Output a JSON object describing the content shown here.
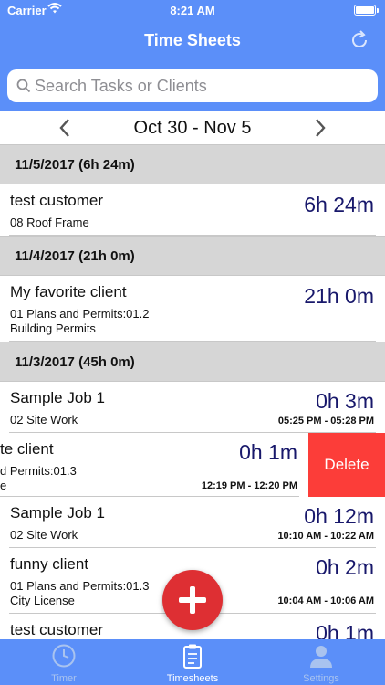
{
  "status": {
    "carrier": "Carrier",
    "time": "8:21 AM"
  },
  "nav": {
    "title": "Time Sheets"
  },
  "search": {
    "placeholder": "Search Tasks or Clients"
  },
  "week": {
    "range": "Oct 30 -  Nov 5"
  },
  "groups": [
    {
      "header": "11/5/2017  (6h 24m)",
      "entries": [
        {
          "client": "test customer",
          "task": "08 Roof Frame",
          "duration": "6h 24m"
        }
      ]
    },
    {
      "header": "11/4/2017  (21h 0m)",
      "entries": [
        {
          "client": "My favorite client",
          "task_line1": "01 Plans and Permits:01.2",
          "task_line2": "Building Permits",
          "duration": "21h 0m"
        }
      ]
    },
    {
      "header": "11/3/2017  (45h 0m)",
      "entries": [
        {
          "client": "Sample Job 1",
          "task": "02 Site Work",
          "duration": "0h 3m",
          "times": "05:25 PM  -  05:28 PM"
        },
        {
          "client": "te client",
          "task_line1": "d Permits:01.3",
          "task_line2": "e",
          "duration": "0h 1m",
          "times": "12:19 PM  -  12:20 PM",
          "action": "Delete"
        },
        {
          "client": "Sample Job 1",
          "task": "02 Site Work",
          "duration": "0h 12m",
          "times": "10:10 AM  -  10:22 AM"
        },
        {
          "client": "funny client",
          "task_line1": "01 Plans and Permits:01.3",
          "task_line2": "City License",
          "duration": "0h 2m",
          "times": "10:04 AM  -  10:06 AM"
        },
        {
          "client": "test customer",
          "duration": "0h 1m"
        }
      ]
    }
  ],
  "tabs": [
    {
      "label": "Timer",
      "icon": "clock-icon"
    },
    {
      "label": "Timesheets",
      "icon": "clipboard-icon"
    },
    {
      "label": "Settings",
      "icon": "person-icon"
    }
  ],
  "colors": {
    "bar": "#5b8ff9",
    "duration": "#18186b",
    "delete": "#fc3d39",
    "fab": "#de2f33"
  }
}
